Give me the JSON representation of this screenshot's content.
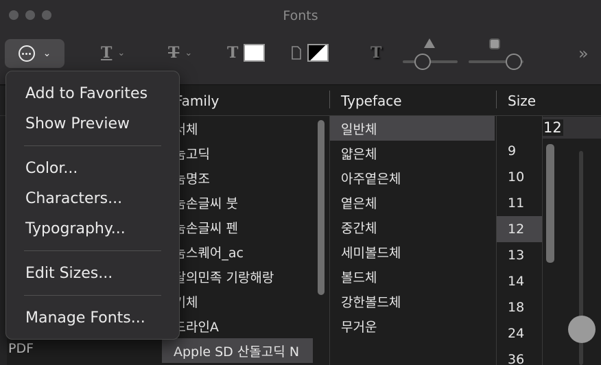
{
  "window": {
    "title": "Fonts"
  },
  "toolbar": {
    "actions_icon": "circle-ellipsis-icon",
    "text_underline_icon": "underline-T-icon",
    "text_strikethrough_icon": "strikethrough-T-icon",
    "text_color_icon": "serif-T-icon",
    "text_color": "#ffffff",
    "document_color_icon": "document-icon",
    "shadow_icon": "shadow-T-icon"
  },
  "menu": {
    "items": [
      {
        "label": "Add to Favorites"
      },
      {
        "label": "Show Preview"
      },
      {
        "label": "Color..."
      },
      {
        "label": "Characters..."
      },
      {
        "label": "Typography..."
      },
      {
        "label": "Edit Sizes..."
      },
      {
        "label": "Manage Fonts..."
      }
    ]
  },
  "columns": {
    "family": "Family",
    "typeface": "Typeface",
    "size": "Size"
  },
  "family_list": [
    "궁서체",
    "나눔고딕",
    "나눔명조",
    "나눔손글씨 붓",
    "나눔손글씨 펜",
    "나눔스퀘어_ac",
    "배달의민족 기랑해랑",
    "필기체",
    "헤드라인A",
    "Apple SD 산돌고딕 N"
  ],
  "typeface_list": [
    "일반체",
    "얇은체",
    "아주옅은체",
    "옅은체",
    "중간체",
    "세미볼드체",
    "볼드체",
    "강한볼드체",
    "무거운"
  ],
  "size_list": [
    "9",
    "10",
    "11",
    "12",
    "13",
    "14",
    "18",
    "24",
    "36"
  ],
  "size_value": "12",
  "sidebar": {
    "bottom_label": "PDF"
  }
}
